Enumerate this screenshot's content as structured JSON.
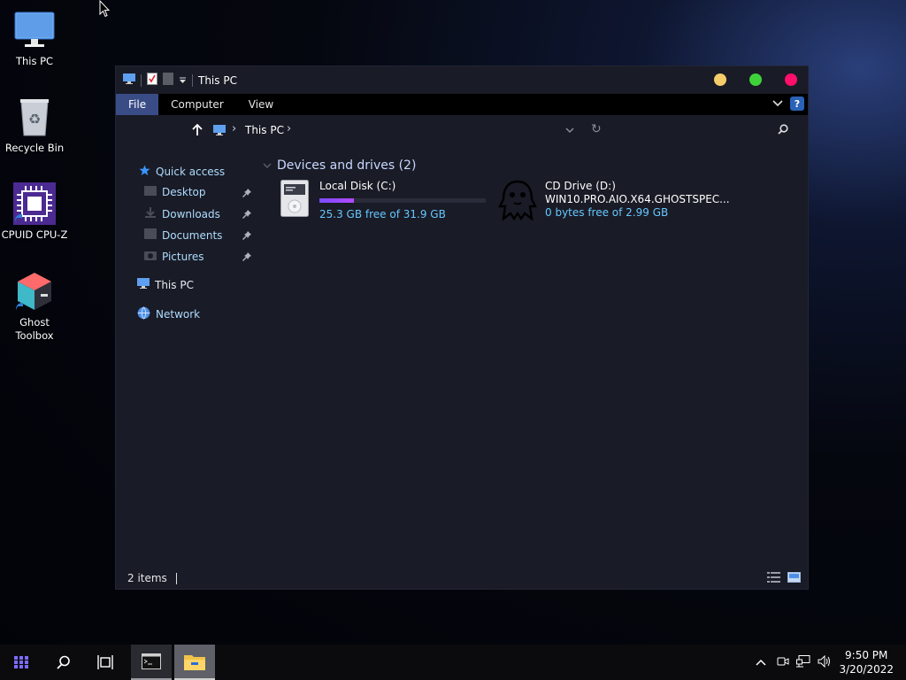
{
  "desktop": {
    "icons": [
      {
        "label": "This PC"
      },
      {
        "label": "Recycle Bin"
      },
      {
        "label": "CPUID CPU-Z"
      },
      {
        "label": "Ghost\nToolbox",
        "line1": "Ghost",
        "line2": "Toolbox"
      }
    ]
  },
  "window": {
    "title": "This PC",
    "ribbon_tabs": [
      "File",
      "Computer",
      "View"
    ],
    "help_label": "?",
    "address": {
      "crumb": "This PC",
      "sep": "›"
    },
    "nav": {
      "quick_access": "Quick access",
      "items": [
        {
          "label": "Desktop"
        },
        {
          "label": "Downloads"
        },
        {
          "label": "Documents"
        },
        {
          "label": "Pictures"
        }
      ],
      "this_pc": "This PC",
      "network": "Network"
    },
    "group": {
      "title": "Devices and drives (2)"
    },
    "drives": [
      {
        "name": "Local Disk (C:)",
        "free_text": "25.3 GB free of 31.9 GB",
        "used_fraction": 0.207
      },
      {
        "name": "CD Drive (D:)",
        "volume": "WIN10.PRO.AIO.X64.GHOSTSPEC...",
        "free_text": "0 bytes free of 2.99 GB"
      }
    ],
    "status": "2 items"
  },
  "colors": {
    "dot_minimize": "#f4cc6a",
    "dot_maximize": "#3fd13a",
    "dot_close": "#ff0f6a",
    "ribbon_active": "#3a4c86",
    "link_blue": "#66c7ff"
  },
  "taskbar": {
    "time": "9:50 PM",
    "date": "3/20/2022"
  }
}
